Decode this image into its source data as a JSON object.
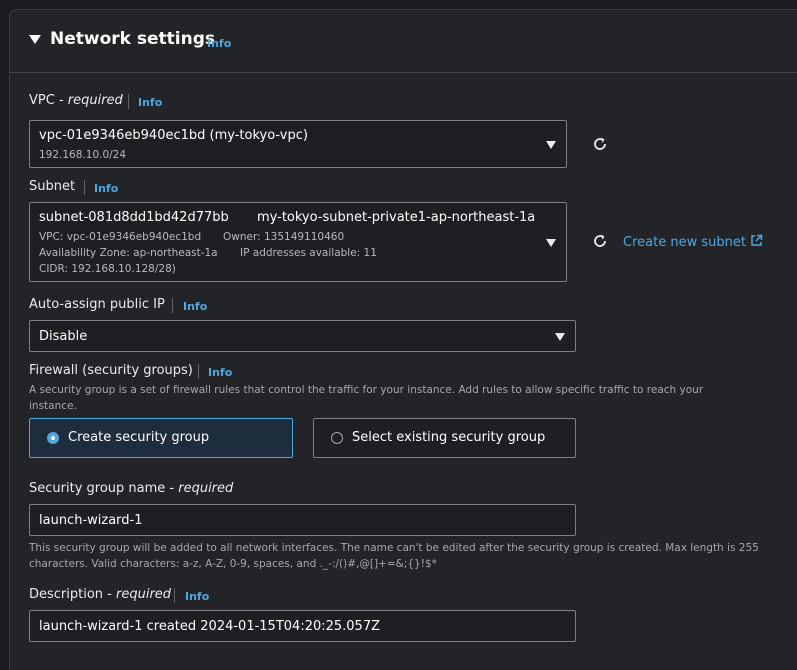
{
  "header": {
    "title": "Network settings",
    "info": "Info"
  },
  "vpc": {
    "label": "VPC - ",
    "required": "required",
    "info": "Info",
    "selected": "vpc-01e9346eb940ec1bd (my-tokyo-vpc)",
    "cidr": "192.168.10.0/24"
  },
  "subnet": {
    "label": "Subnet",
    "info": "Info",
    "selected_id": "subnet-081d8dd1bd42d77bb",
    "selected_name": "my-tokyo-subnet-private1-ap-northeast-1a",
    "vpc_line": "VPC: vpc-01e9346eb940ec1bd",
    "owner_line": "Owner: 135149110460",
    "az_line": "Availability Zone: ap-northeast-1a",
    "ips_line": "IP addresses available: 11",
    "cidr_line": "CIDR: 192.168.10.128/28)",
    "create_link": "Create new subnet"
  },
  "public_ip": {
    "label": "Auto-assign public IP",
    "info": "Info",
    "selected": "Disable"
  },
  "firewall": {
    "label": "Firewall (security groups)",
    "info": "Info",
    "description": "A security group is a set of firewall rules that control the traffic for your instance. Add rules to allow specific traffic to reach your instance.",
    "options": [
      "Create security group",
      "Select existing security group"
    ],
    "selected_index": 0
  },
  "sg_name": {
    "label": "Security group name - ",
    "required": "required",
    "value": "launch-wizard-1",
    "help": "This security group will be added to all network interfaces. The name can't be edited after the security group is created. Max length is 255 characters. Valid characters: a-z, A-Z, 0-9, spaces, and ._-:/()#,@[]+=&;{}!$*"
  },
  "description": {
    "label": "Description - ",
    "required": "required",
    "info": "Info",
    "value": "launch-wizard-1 created 2024-01-15T04:20:25.057Z"
  },
  "colors": {
    "accent": "#4ea8de",
    "selected_border": "#4ea8de",
    "background": "#232428"
  },
  "icons": [
    "caret-down-icon",
    "refresh-icon",
    "external-link-icon",
    "dropdown-arrow-icon"
  ]
}
